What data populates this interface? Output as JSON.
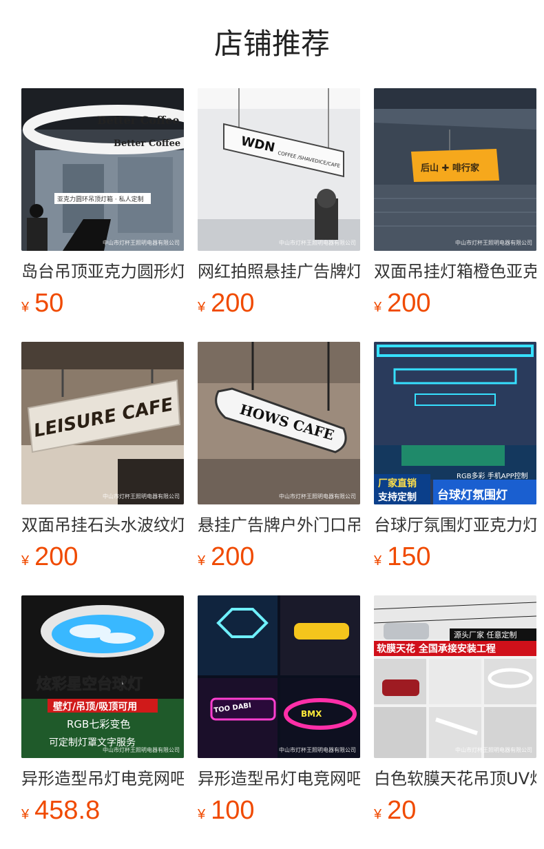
{
  "page": {
    "title": "店铺推荐"
  },
  "watermark": "中山市灯杯王照明电器有限公司",
  "products": [
    {
      "name": "岛台吊顶亚克力圆形灯箱",
      "currency": "¥",
      "price": "50",
      "image_text": [
        "Better Coffee",
        "Better Coffee",
        "亚克力圆环吊顶灯箱 · 私人定制"
      ]
    },
    {
      "name": "网红拍照悬挂广告牌灯箱",
      "currency": "¥",
      "price": "200",
      "image_text": [
        "WDN",
        "COFFEE /SHAVEDICE/CAFE"
      ]
    },
    {
      "name": "双面吊挂灯箱橙色亚克力",
      "currency": "¥",
      "price": "200",
      "image_text": [
        "后山 ✚ 啡行家"
      ]
    },
    {
      "name": "双面吊挂石头水波纹灯箱",
      "currency": "¥",
      "price": "200",
      "image_text": [
        "LEISURE CAFE"
      ]
    },
    {
      "name": "悬挂广告牌户外门口吊牌",
      "currency": "¥",
      "price": "200",
      "image_text": [
        "HOWS CAFE"
      ]
    },
    {
      "name": "台球厅氛围灯亚克力灯箱",
      "currency": "¥",
      "price": "150",
      "image_text": [
        "厂家直销",
        "支持定制",
        "RGB多彩 手机APP控制",
        "台球灯氛围灯"
      ]
    },
    {
      "name": "异形造型吊灯电竞网吧灯",
      "currency": "¥",
      "price": "458.8",
      "image_text": [
        "炫彩星空台球灯",
        "壁灯/吊顶/吸顶可用",
        "RGB七彩变色",
        "可定制灯罩文字服务"
      ]
    },
    {
      "name": "异形造型吊灯电竞网吧灯",
      "currency": "¥",
      "price": "100",
      "image_text": [
        "TOO DABI",
        "BMX"
      ]
    },
    {
      "name": "白色软膜天花吊顶UV灯",
      "currency": "¥",
      "price": "20",
      "image_text": [
        "源头厂家 任意定制",
        "软膜天花 全国承接安装工程"
      ]
    }
  ]
}
